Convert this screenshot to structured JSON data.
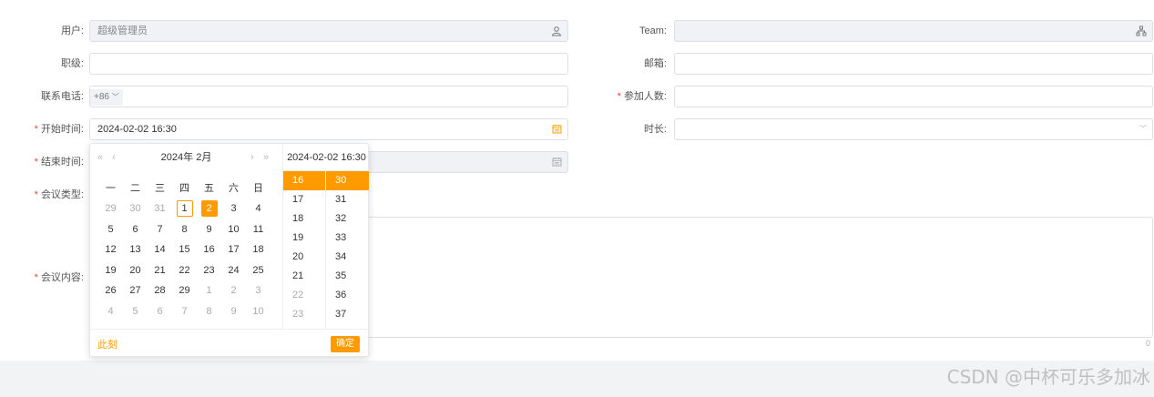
{
  "form": {
    "user": {
      "label": "用户:",
      "value": "超级管理员",
      "icon": "user-icon"
    },
    "team": {
      "label": "Team:",
      "value": "",
      "icon": "org-tree-icon"
    },
    "rank": {
      "label": "职级:",
      "value": ""
    },
    "email": {
      "label": "邮箱:",
      "value": ""
    },
    "phone": {
      "label": "联系电话:",
      "prefix": "+86",
      "value": ""
    },
    "participants": {
      "label": "参加人数:",
      "required": "*",
      "value": ""
    },
    "start_time": {
      "label": "开始时间:",
      "required": "*",
      "value": "2024-02-02 16:30",
      "icon": "calendar-icon"
    },
    "duration": {
      "label": "时长:",
      "value": "",
      "icon": "chevron-down-icon"
    },
    "end_time": {
      "label": "结束时间:",
      "required": "*",
      "value": "",
      "icon": "calendar-icon"
    },
    "meeting_type": {
      "label": "会议类型:",
      "required": "*"
    },
    "meeting_content": {
      "label": "会议内容:",
      "required": "*",
      "counter": "0"
    }
  },
  "picker": {
    "nav_prev_year": "«",
    "nav_prev_month": "‹",
    "nav_next_month": "›",
    "nav_next_year": "»",
    "year_label": "2024年",
    "month_label": "2月",
    "time_header": "2024-02-02 16:30",
    "weekdays": [
      "一",
      "二",
      "三",
      "四",
      "五",
      "六",
      "日"
    ],
    "weeks": [
      [
        "29",
        "30",
        "31",
        "1",
        "2",
        "3",
        "4"
      ],
      [
        "5",
        "6",
        "7",
        "8",
        "9",
        "10",
        "11"
      ],
      [
        "12",
        "13",
        "14",
        "15",
        "16",
        "17",
        "18"
      ],
      [
        "19",
        "20",
        "21",
        "22",
        "23",
        "24",
        "25"
      ],
      [
        "26",
        "27",
        "28",
        "29",
        "1",
        "2",
        "3"
      ],
      [
        "4",
        "5",
        "6",
        "7",
        "8",
        "9",
        "10"
      ]
    ],
    "today": "1",
    "selected": "2",
    "hours": [
      "16",
      "17",
      "18",
      "19",
      "20",
      "21",
      "22",
      "23"
    ],
    "minutes": [
      "30",
      "31",
      "32",
      "33",
      "34",
      "35",
      "36",
      "37"
    ],
    "selected_hour": "16",
    "selected_minute": "30",
    "now_label": "此刻",
    "confirm_label": "确定"
  },
  "watermark": "CSDN @中杯可乐多加冰",
  "colors": {
    "accent": "#ff9a00",
    "required": "#f04040",
    "disabled_bg": "#f0f2f6"
  }
}
